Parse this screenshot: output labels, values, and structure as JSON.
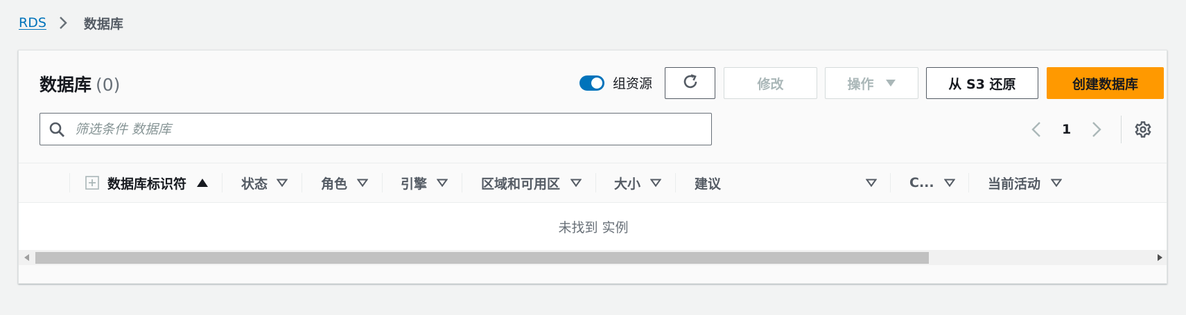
{
  "breadcrumb": {
    "root": "RDS",
    "current": "数据库"
  },
  "panel": {
    "title": "数据库",
    "count": "(0)"
  },
  "toolbar": {
    "group_resources_label": "组资源",
    "group_resources_enabled": true,
    "modify_label": "修改",
    "actions_label": "操作",
    "restore_label": "从 S3 还原",
    "create_label": "创建数据库"
  },
  "search": {
    "placeholder": "筛选条件 数据库",
    "value": ""
  },
  "pagination": {
    "current_page": "1"
  },
  "table": {
    "columns": [
      {
        "label": "数据库标识符",
        "sort": "ascending"
      },
      {
        "label": "状态",
        "sort": "none"
      },
      {
        "label": "角色",
        "sort": "none"
      },
      {
        "label": "引擎",
        "sort": "none"
      },
      {
        "label": "区域和可用区",
        "sort": "none"
      },
      {
        "label": "大小",
        "sort": "none"
      },
      {
        "label": "建议",
        "sort": "none"
      },
      {
        "label": "C...",
        "sort": "none"
      },
      {
        "label": "当前活动",
        "sort": "none"
      }
    ],
    "empty_message": "未找到 实例"
  },
  "colors": {
    "accent": "#0073bb",
    "primary_button": "#ff9900",
    "background": "#f2f3f3"
  },
  "icons": [
    "chevron-right-icon",
    "refresh-icon",
    "caret-down-icon",
    "search-icon",
    "chevron-left-icon",
    "gear-icon",
    "expand-icon",
    "sort-ascending-icon",
    "sort-descending-icon"
  ]
}
